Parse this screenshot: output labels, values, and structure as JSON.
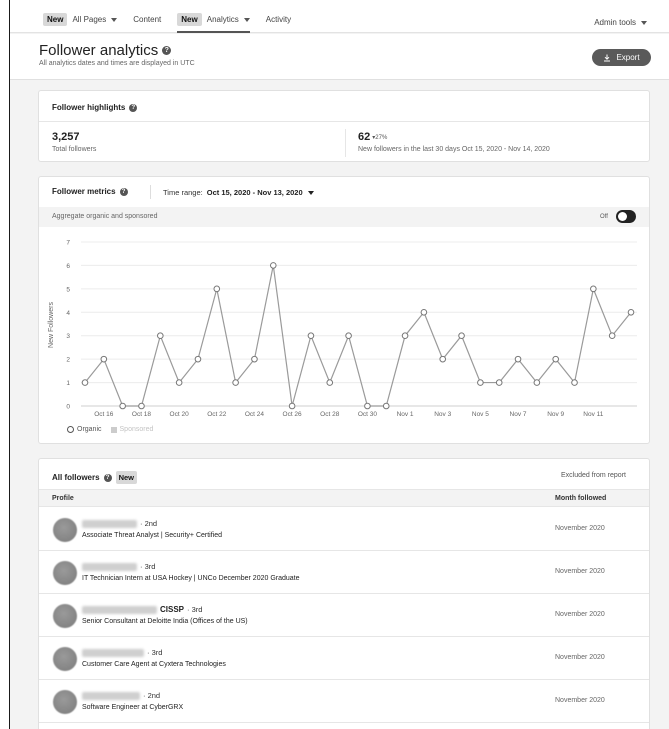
{
  "nav": {
    "items": [
      {
        "badge": "New",
        "label": "All Pages",
        "dropdown": true,
        "active": false
      },
      {
        "badge": "",
        "label": "Content",
        "dropdown": false,
        "active": false
      },
      {
        "badge": "New",
        "label": "Analytics",
        "dropdown": true,
        "active": true
      },
      {
        "badge": "",
        "label": "Activity",
        "dropdown": false,
        "active": false
      }
    ],
    "admin_tools": "Admin tools"
  },
  "header": {
    "title": "Follower analytics",
    "subtitle": "All analytics dates and times are displayed in UTC",
    "export_label": "Export",
    "export_icon": "download-icon"
  },
  "highlights": {
    "title": "Follower highlights",
    "total_value": "3,257",
    "total_label": "Total followers",
    "new_value": "62",
    "new_change": "27%",
    "new_change_direction": "down",
    "new_label": "New followers in the last 30 days Oct 15, 2020 - Nov 14, 2020"
  },
  "metrics": {
    "title": "Follower metrics",
    "time_range_label": "Time range:",
    "time_range_value": "Oct 15, 2020 - Nov 13, 2020",
    "aggregate_label": "Aggregate organic and sponsored",
    "toggle_label": "Off",
    "toggle_on": false,
    "legend": {
      "organic": "Organic",
      "sponsored": "Sponsored"
    }
  },
  "chart_data": {
    "type": "line",
    "title": "",
    "xlabel": "",
    "ylabel": "New Followers",
    "ylim": [
      0,
      7
    ],
    "yticks": [
      0,
      1,
      2,
      3,
      4,
      5,
      6,
      7
    ],
    "x": [
      "Oct 15",
      "Oct 16",
      "Oct 17",
      "Oct 18",
      "Oct 19",
      "Oct 20",
      "Oct 21",
      "Oct 22",
      "Oct 23",
      "Oct 24",
      "Oct 25",
      "Oct 26",
      "Oct 27",
      "Oct 28",
      "Oct 29",
      "Oct 30",
      "Oct 31",
      "Nov 1",
      "Nov 2",
      "Nov 3",
      "Nov 4",
      "Nov 5",
      "Nov 6",
      "Nov 7",
      "Nov 8",
      "Nov 9",
      "Nov 10",
      "Nov 11",
      "Nov 12",
      "Nov 13"
    ],
    "xtick_labels": [
      "Oct 16",
      "Oct 18",
      "Oct 20",
      "Oct 22",
      "Oct 24",
      "Oct 26",
      "Oct 28",
      "Oct 30",
      "Nov 1",
      "Nov 3",
      "Nov 5",
      "Nov 7",
      "Nov 9",
      "Nov 11"
    ],
    "series": [
      {
        "name": "Organic",
        "values": [
          1,
          2,
          0,
          0,
          3,
          1,
          2,
          5,
          1,
          2,
          6,
          0,
          3,
          1,
          3,
          0,
          0,
          3,
          4,
          2,
          3,
          1,
          1,
          2,
          1,
          2,
          1,
          5,
          3,
          4
        ]
      }
    ],
    "grid": true,
    "legend_position": "bottom-left"
  },
  "followers": {
    "title": "All followers",
    "new_badge": "New",
    "excluded": "Excluded from report",
    "col_profile": "Profile",
    "col_month": "Month followed",
    "rows": [
      {
        "name_extra": "",
        "degree": "· 2nd",
        "headline": "Associate Threat Analyst | Security+ Certified",
        "month": "November 2020"
      },
      {
        "name_extra": "",
        "degree": "· 3rd",
        "headline": "IT Technician Intern at USA Hockey | UNCo December 2020 Graduate",
        "month": "November 2020"
      },
      {
        "name_extra": "CISSP",
        "degree": "· 3rd",
        "headline": "Senior Consultant at Deloitte India (Offices of the US)",
        "month": "November 2020"
      },
      {
        "name_extra": "",
        "degree": "· 3rd",
        "headline": "Customer Care Agent at Cyxtera Technologies",
        "month": "November 2020"
      },
      {
        "name_extra": "",
        "degree": "· 2nd",
        "headline": "Software Engineer at CyberGRX",
        "month": "November 2020"
      }
    ]
  }
}
